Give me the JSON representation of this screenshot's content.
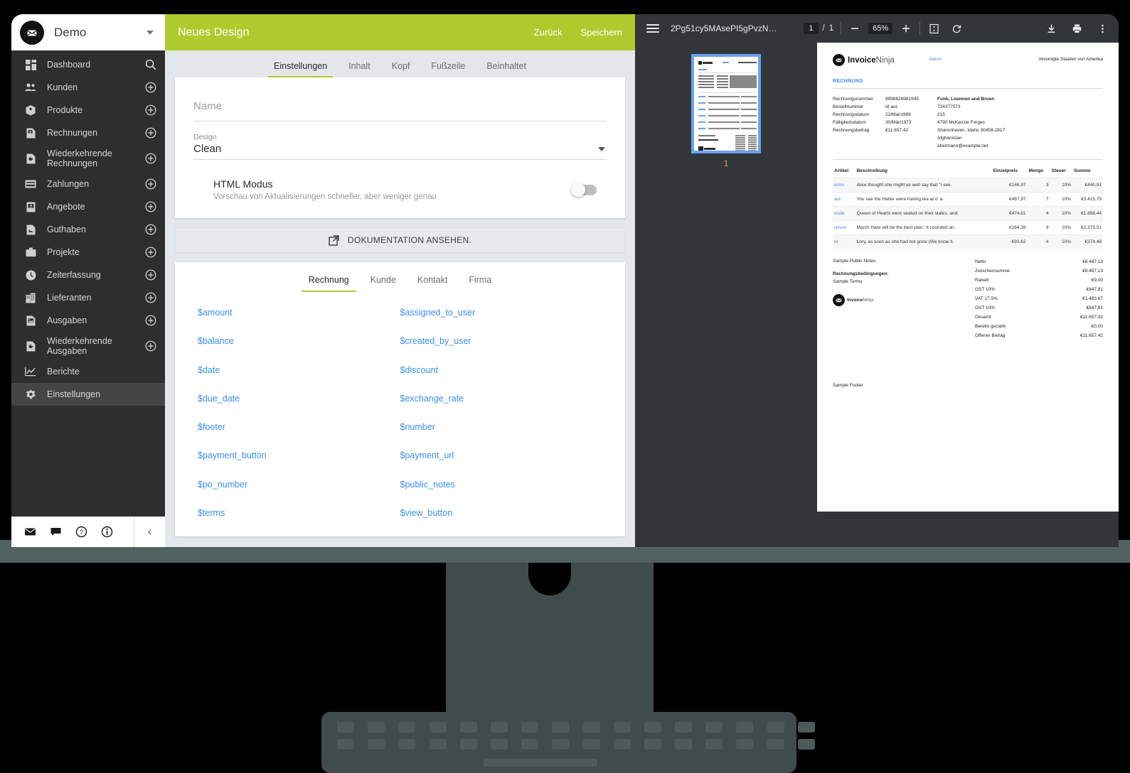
{
  "sidebar": {
    "account": {
      "name": "Demo",
      "logo_icon": "envelope-logo-icon",
      "dropdown_icon": "chevron-down-icon"
    },
    "items": [
      {
        "label": "Dashboard",
        "icon": "dashboard-icon",
        "action_icon": "search-icon"
      },
      {
        "label": "Kunden",
        "icon": "people-icon",
        "action_icon": "plus-circle-icon"
      },
      {
        "label": "Produkte",
        "icon": "box-icon",
        "action_icon": "plus-circle-icon"
      },
      {
        "label": "Rechnungen",
        "icon": "invoice-icon",
        "action_icon": "plus-circle-icon"
      },
      {
        "label": "Wiederkehrende Rechnungen",
        "icon": "recurring-invoice-icon",
        "action_icon": "plus-circle-icon"
      },
      {
        "label": "Zahlungen",
        "icon": "card-icon",
        "action_icon": "plus-circle-icon"
      },
      {
        "label": "Angebote",
        "icon": "quote-icon",
        "action_icon": "plus-circle-icon"
      },
      {
        "label": "Guthaben",
        "icon": "credit-icon",
        "action_icon": "plus-circle-icon"
      },
      {
        "label": "Projekte",
        "icon": "briefcase-icon",
        "action_icon": "plus-circle-icon"
      },
      {
        "label": "Zeiterfassung",
        "icon": "clock-icon",
        "action_icon": "plus-circle-icon"
      },
      {
        "label": "Lieferanten",
        "icon": "building-icon",
        "action_icon": "plus-circle-icon"
      },
      {
        "label": "Ausgaben",
        "icon": "expense-icon",
        "action_icon": "plus-circle-icon"
      },
      {
        "label": "Wiederkehrende Ausgaben",
        "icon": "recurring-expense-icon",
        "action_icon": "plus-circle-icon"
      },
      {
        "label": "Berichte",
        "icon": "chart-icon",
        "action_icon": ""
      },
      {
        "label": "Einstellungen",
        "icon": "gear-icon",
        "action_icon": "",
        "active": true
      }
    ],
    "footer_icons": [
      "mail-icon",
      "chat-icon",
      "help-icon",
      "info-icon"
    ],
    "collapse_icon": "chevron-left-icon"
  },
  "appbar": {
    "title": "Neues Design",
    "back_label": "Zurück",
    "save_label": "Speichern",
    "accent_color": "#aecb2e"
  },
  "tabs": [
    {
      "label": "Einstellungen",
      "active": true
    },
    {
      "label": "Inhalt",
      "active": false
    },
    {
      "label": "Kopf",
      "active": false
    },
    {
      "label": "Fußzeile",
      "active": false
    },
    {
      "label": "Beinhaltet",
      "active": false
    }
  ],
  "settings": {
    "name_field": {
      "placeholder": "Name",
      "value": ""
    },
    "design_field": {
      "label": "Design",
      "value": "Clean",
      "dropdown_icon": "caret-down-icon"
    },
    "html_mode": {
      "title": "HTML Modus",
      "subtitle": "Vorschau von Aktualisierungen schneller, aber weniger genau",
      "enabled": false
    },
    "documentation_button": {
      "label": "DOKUMENTATION ANSEHEN.",
      "icon": "external-link-icon"
    }
  },
  "variables": {
    "tabs": [
      {
        "label": "Rechnung",
        "active": true
      },
      {
        "label": "Kunde",
        "active": false
      },
      {
        "label": "Kontakt",
        "active": false
      },
      {
        "label": "Firma",
        "active": false
      }
    ],
    "left": [
      "$amount",
      "$balance",
      "$date",
      "$due_date",
      "$footer",
      "$payment_button",
      "$po_number",
      "$terms"
    ],
    "right": [
      "$assigned_to_user",
      "$created_by_user",
      "$discount",
      "$exchange_rate",
      "$number",
      "$payment_url",
      "$public_notes",
      "$view_button"
    ],
    "link_color": "#3a8ef0"
  },
  "pdf_viewer": {
    "menu_icon": "hamburger-icon",
    "filename": "2Pg51cy5MAsePI5gPvzN…",
    "current_page": "1",
    "page_separator": "/",
    "total_pages": "1",
    "zoom_out_icon": "minus-icon",
    "zoom_level": "65%",
    "zoom_in_icon": "plus-icon",
    "fit_icon": "fit-page-icon",
    "rotate_icon": "rotate-icon",
    "download_icon": "download-icon",
    "print_icon": "print-icon",
    "more_icon": "more-vertical-icon",
    "thumbnail_page_label": "1"
  },
  "invoice": {
    "logo_bold": "Invoice",
    "logo_light": "Ninja",
    "company_link": "Demo",
    "country": "Vereinigte Staaten von Amerika",
    "doc_type": "RECHNUNG",
    "meta": [
      {
        "key": "Rechnungsnummer",
        "value": "8998626981945"
      },
      {
        "key": "Bestellnummer",
        "value": "Id aut."
      },
      {
        "key": "Rechnungsdatum",
        "value": "22/Mai/1989"
      },
      {
        "key": "Fälligkeitsdatum",
        "value": "30/Mär/1973"
      },
      {
        "key": "Rechnungsbetrag",
        "value": "€11.657,42"
      }
    ],
    "client": [
      "Funk, Leannon and Bruen",
      "724377573",
      "215",
      "4790 McKenzie Forges",
      "Sharonhaven, Idaho 30458-2817",
      "Afghanistan",
      "ahermann@example.net"
    ],
    "table_headers": [
      "Artikel",
      "Beschreibung",
      "Einzelpreis",
      "Menge",
      "Steuer",
      "Summe"
    ],
    "rows": [
      {
        "artikel": "enim",
        "beschreibung": "Alice thought she might as well say that \"I see.",
        "einzelpreis": "€146,97",
        "menge": "3",
        "steuer": "10%",
        "summe": "€440,91"
      },
      {
        "artikel": "aut",
        "beschreibung": "You see the Hatter were having tea at it: a.",
        "einzelpreis": "€487,97",
        "menge": "7",
        "steuer": "10%",
        "summe": "€3.415,79"
      },
      {
        "artikel": "unde",
        "beschreibung": "Queen of Hearts were seated on their slates, and.",
        "einzelpreis": "€474,61",
        "menge": "4",
        "steuer": "10%",
        "summe": "€1.898,44"
      },
      {
        "artikel": "rerum",
        "beschreibung": "March Hare will be the best plan.' It sounded an.",
        "einzelpreis": "€264,39",
        "menge": "9",
        "steuer": "10%",
        "summe": "€2.379,51"
      },
      {
        "artikel": "et",
        "beschreibung": "Lory, as soon as she had not gone (We know it.",
        "einzelpreis": "€93,62",
        "menge": "4",
        "steuer": "10%",
        "summe": "€374,48"
      }
    ],
    "public_notes": "Sample Public Notes",
    "terms_label": "Rechnungsbedingungen:",
    "terms_value": "Sample Terms",
    "totals": [
      {
        "label": "Netto",
        "value": "€8.487,13"
      },
      {
        "label": "Zwischensumme",
        "value": "€8.487,13"
      },
      {
        "label": "Rabatt",
        "value": "€9,00"
      },
      {
        "label": "GST 10%",
        "value": "€847,81"
      },
      {
        "label": "VAT 17.5%",
        "value": "€1.483,67"
      },
      {
        "label": "GST 10%",
        "value": "€847,81"
      },
      {
        "label": "Gesamt",
        "value": "€11.657,42"
      },
      {
        "label": "Bereits gezahlt",
        "value": "€0,00"
      },
      {
        "label": "Offener Betrag",
        "value": "€11.657,42"
      }
    ],
    "footer_text": "Sample Footer"
  }
}
